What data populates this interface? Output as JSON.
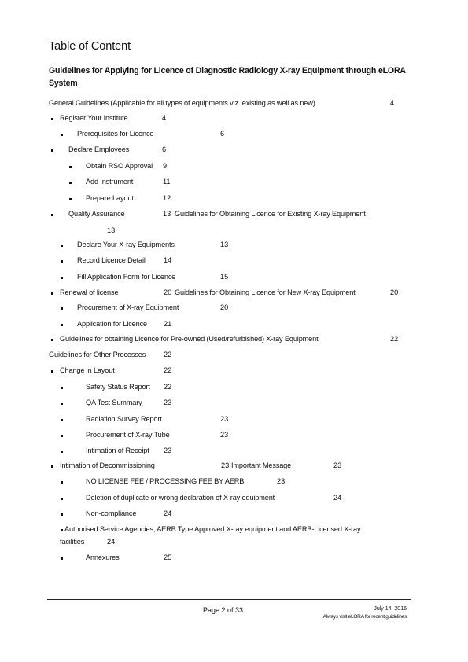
{
  "title": "Table of Content",
  "heading": "Guidelines for Applying for Licence of Diagnostic Radiology X-ray Equipment through eLORA System",
  "toc": [
    {
      "text": "General Guidelines (Applicable for all types of equipments viz. existing as well as new)",
      "page": "4"
    },
    {
      "text": "Register Your Institute",
      "page": "4"
    },
    {
      "text": "Prerequisites for Licence",
      "page": "6"
    },
    {
      "text": "Declare Employees",
      "page": "6"
    },
    {
      "text": "Obtain RSO Approval",
      "page": "9"
    },
    {
      "text": "Add Instrument",
      "page": "11"
    },
    {
      "text": "Prepare Layout",
      "page": "12"
    },
    {
      "text": "Quality Assurance",
      "page": "13",
      "continued_text": "Guidelines for Obtaining Licence for Existing X-ray Equipment",
      "continued_page": "13"
    },
    {
      "text": "Declare Your X-ray Equipments",
      "page": "13"
    },
    {
      "text": "Record Licence Detail",
      "page": "14"
    },
    {
      "text": "Fill Application Form for Licence",
      "page": "15"
    },
    {
      "text": "Renewal of license",
      "page": "20",
      "continued_text": "Guidelines for Obtaining Licence for New X-ray Equipment",
      "continued_page": "20"
    },
    {
      "text": "Procurement of X-ray Equipment",
      "page": "20"
    },
    {
      "text": "Application for Licence",
      "page": "21"
    },
    {
      "text": "Guidelines for obtaining Licence for Pre-owned (Used/refurbished) X-ray Equipment",
      "page": "22"
    },
    {
      "text": "Guidelines for Other Processes",
      "page": "22"
    },
    {
      "text": "Change in Layout",
      "page": "22"
    },
    {
      "text": "Safety Status Report",
      "page": "22"
    },
    {
      "text": "QA Test Summary",
      "page": "23"
    },
    {
      "text": "Radiation Survey Report",
      "page": "23"
    },
    {
      "text": "Procurement of X-ray Tube",
      "page": "23"
    },
    {
      "text": "Intimation of Receipt",
      "page": "23"
    },
    {
      "text": "Intimation of Decommissioning",
      "page": "23",
      "continued_text": "Important Message",
      "continued_page": "23"
    },
    {
      "text": "NO LICENSE FEE / PROCESSING FEE BY AERB",
      "page": "23"
    },
    {
      "text": "Deletion of duplicate or wrong declaration of X-ray equipment",
      "page": "24"
    },
    {
      "text": "Non-compliance",
      "page": "24"
    },
    {
      "text": "Authorised Service Agencies, AERB Type Approved X-ray equipment and AERB-Licensed X-ray",
      "text_line2": "facilities",
      "page": "24"
    },
    {
      "text": "Annexures",
      "page": "25"
    }
  ],
  "footer": {
    "page": "Page 2 of 33",
    "date": "July 14, 2016",
    "note": "Always visit eLORA for recent guidelines"
  }
}
